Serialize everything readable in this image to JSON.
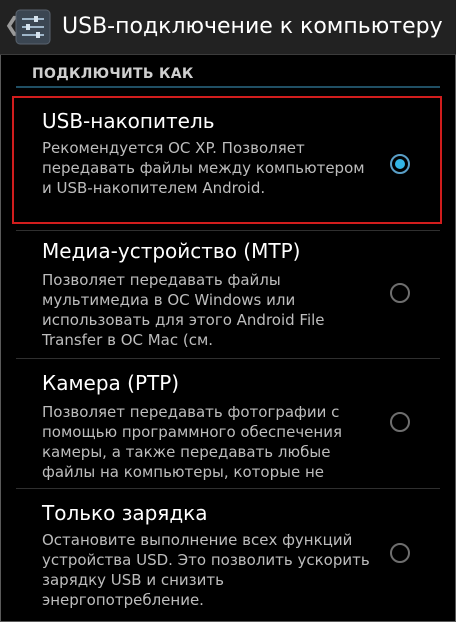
{
  "header": {
    "title": "USB-подключение к компьютеру",
    "back_icon": "chevron-left-icon",
    "app_icon": "settings-sliders-icon"
  },
  "section": {
    "title": "ПОДКЛЮЧИТЬ КАК"
  },
  "options": [
    {
      "title": "USB-накопитель",
      "summary": "Рекомендуется ОС XP. Позволяет передавать файлы между компьютером и USB-накопителем Android.",
      "checked": true
    },
    {
      "title": "Медиа-устройство (MTP)",
      "summary": "Позволяет передавать файлы мультимедиа в ОС Windows или использовать для этого Android File Transfer в ОС Mac (см.",
      "checked": false
    },
    {
      "title": "Камера (PTP)",
      "summary": "Позволяет передавать фотографии с помощью программного обеспечения камеры, а также передавать любые файлы на компьютеры, которые не",
      "checked": false
    },
    {
      "title": "Только зарядка",
      "summary": "Остановите выполнение всех функций устройства USD. Это позволить ускорить зарядку USB и снизить энергопотребление.",
      "checked": false
    }
  ],
  "colors": {
    "accent": "#33b5e5",
    "highlight": "#d11d1d",
    "background": "#000000"
  }
}
